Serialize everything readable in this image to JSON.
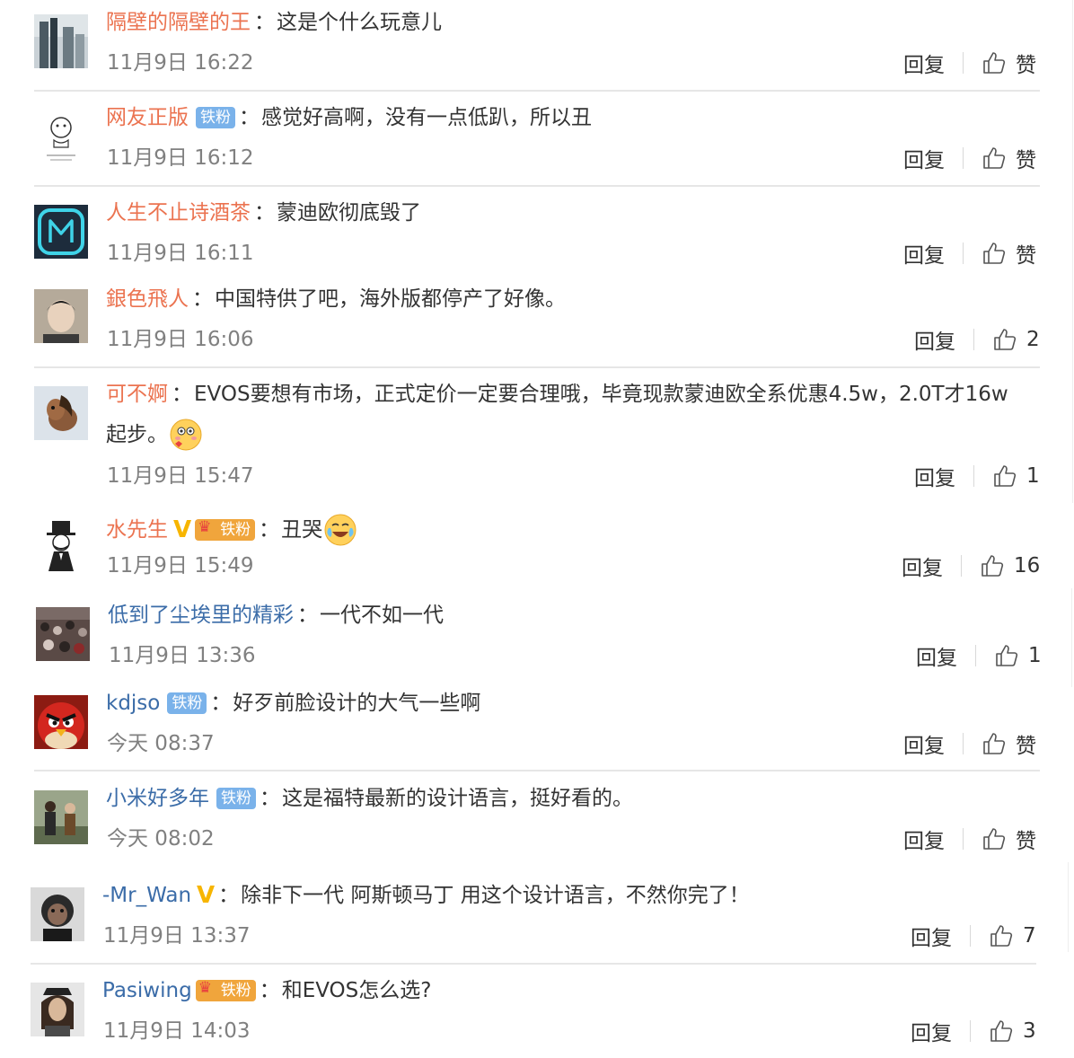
{
  "comments": [
    {
      "username": "隔壁的隔壁的王",
      "badges": [],
      "text": "这是个什么玩意儿",
      "time": "11月9日 16:22",
      "reply": "回复",
      "like": "赞",
      "avatar_icon": "city-building-avatar-icon"
    },
    {
      "username": "网友正版",
      "badges": [
        "铁粉"
      ],
      "text": "感觉好高啊，没有一点低趴，所以丑",
      "time": "11月9日 16:12",
      "reply": "回复",
      "like": "赞",
      "avatar_icon": "cartoon-sketch-avatar-icon"
    },
    {
      "username": "人生不止诗酒茶",
      "badges": [],
      "text": "蒙迪欧彻底毁了",
      "time": "11月9日 16:11",
      "reply": "回复",
      "like": "赞",
      "avatar_icon": "letter-m-avatar-icon"
    },
    {
      "username": "銀色飛人",
      "badges": [],
      "text": "中国特供了吧，海外版都停产了好像。",
      "time": "11月9日 16:06",
      "reply": "回复",
      "like": "2",
      "avatar_icon": "person-photo-avatar-icon"
    },
    {
      "username": "可不婀",
      "badges": [],
      "text": "EVOS要想有市场，正式定价一定要合理哦，毕竟现款蒙迪欧全系优惠4.5w，2.0T才16w",
      "text2": "起步。",
      "time": "11月9日 15:47",
      "reply": "回复",
      "like": "1",
      "avatar_icon": "pony-avatar-icon"
    },
    {
      "username": "水先生",
      "badges": [
        "V",
        "铁粉"
      ],
      "text": "丑哭",
      "time": "11月9日 15:49",
      "reply": "回复",
      "like": "16",
      "avatar_icon": "top-hat-gentleman-avatar-icon"
    },
    {
      "username": "低到了尘埃里的精彩",
      "badges": [],
      "text": "一代不如一代",
      "time": "11月9日 13:36",
      "reply": "回复",
      "like": "1",
      "avatar_icon": "crowd-photo-avatar-icon"
    },
    {
      "username": "kdjso",
      "badges": [
        "铁粉"
      ],
      "text": "好歹前脸设计的大气一些啊",
      "time": "今天 08:37",
      "reply": "回复",
      "like": "赞",
      "avatar_icon": "angry-bird-avatar-icon"
    },
    {
      "username": "小米好多年",
      "badges": [
        "铁粉"
      ],
      "text": "这是福特最新的设计语言，挺好看的。",
      "time": "今天 08:02",
      "reply": "回复",
      "like": "赞",
      "avatar_icon": "movie-still-avatar-icon"
    },
    {
      "username": "-Mr_Wan",
      "badges": [
        "V"
      ],
      "text": "除非下一代 阿斯顿马丁 用这个设计语言，不然你完了！",
      "time": "11月9日 13:37",
      "reply": "回复",
      "like": "7",
      "avatar_icon": "monkey-avatar-icon"
    },
    {
      "username": "Pasiwing",
      "badges": [
        "铁粉"
      ],
      "text": "和EVOS怎么选?",
      "time": "11月9日 14:03",
      "reply": "回复",
      "like": "3",
      "avatar_icon": "long-hair-man-avatar-icon"
    }
  ],
  "colors": {
    "username": "#eb7350",
    "username_blue": "#3b6ca8",
    "fan_badge": "#7ab2ea",
    "v_badge": "#f7b500"
  }
}
